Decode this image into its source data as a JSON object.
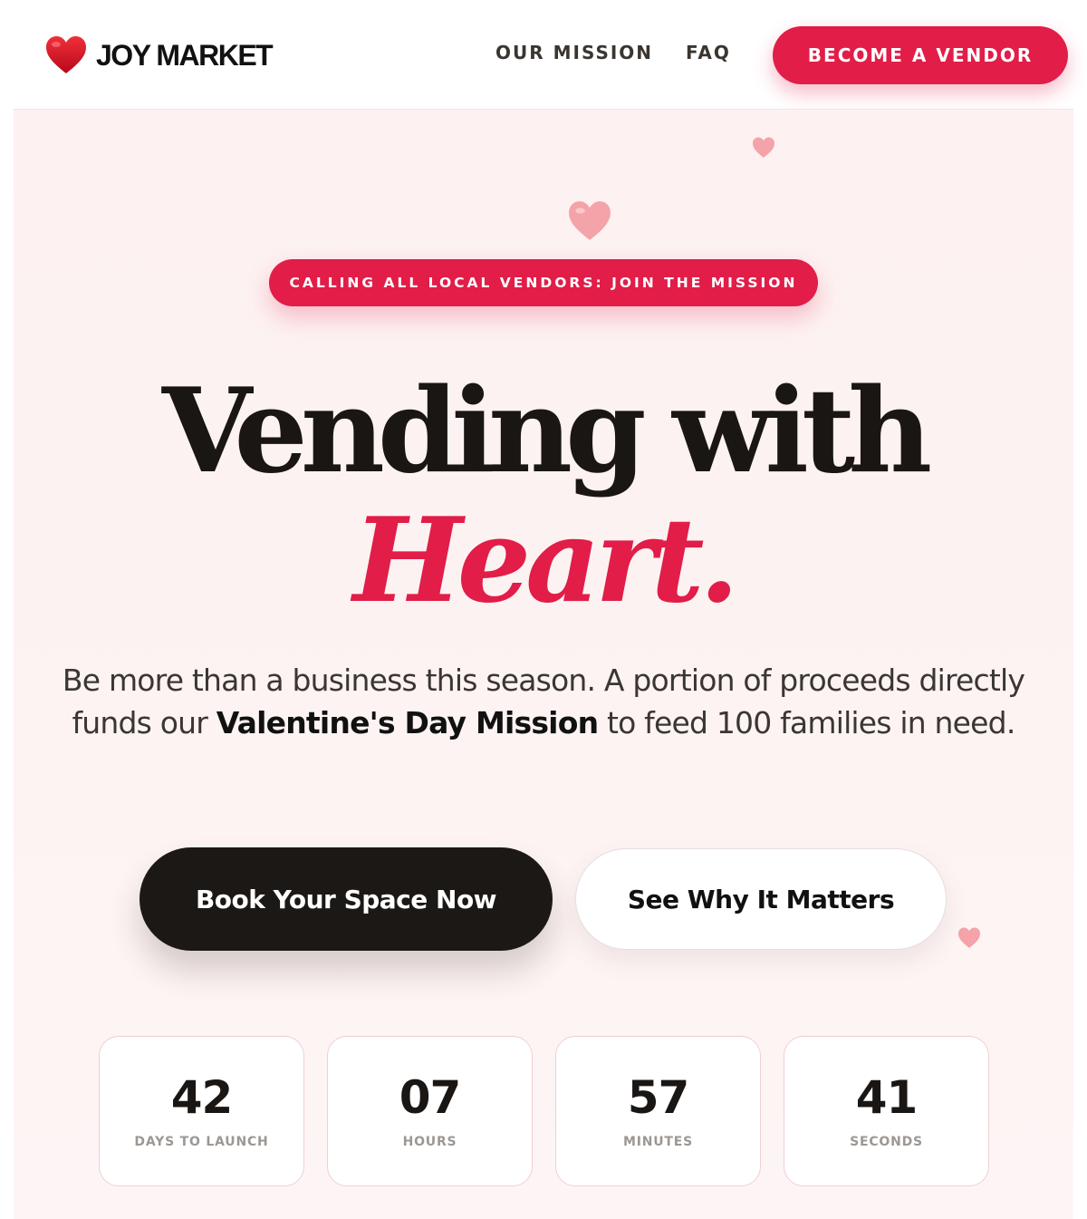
{
  "brand": {
    "name": "JOY MARKET",
    "logo_icon": "heart-icon",
    "accent": "#e11d48"
  },
  "nav": {
    "our_mission": "OUR MISSION",
    "faq": "FAQ",
    "become_vendor": "BECOME A VENDOR"
  },
  "hero": {
    "pill": "CALLING ALL LOCAL VENDORS: JOIN THE MISSION",
    "headline_line1": "Vending with",
    "headline_line2": "Heart.",
    "subtext_before": "Be more than a business this season. A portion of proceeds directly funds our ",
    "subtext_bold": "Valentine's Day Mission",
    "subtext_after": " to feed 100 families in need.",
    "primary_cta": "Book Your Space Now",
    "secondary_cta": "See Why It Matters"
  },
  "countdown": [
    {
      "value": "42",
      "label": "DAYS TO LAUNCH"
    },
    {
      "value": "07",
      "label": "HOURS"
    },
    {
      "value": "57",
      "label": "MINUTES"
    },
    {
      "value": "41",
      "label": "SECONDS"
    }
  ],
  "colors": {
    "dark": "#1c1816",
    "soft_heart": "#f4a3a8",
    "background": "#fdf2f2"
  }
}
